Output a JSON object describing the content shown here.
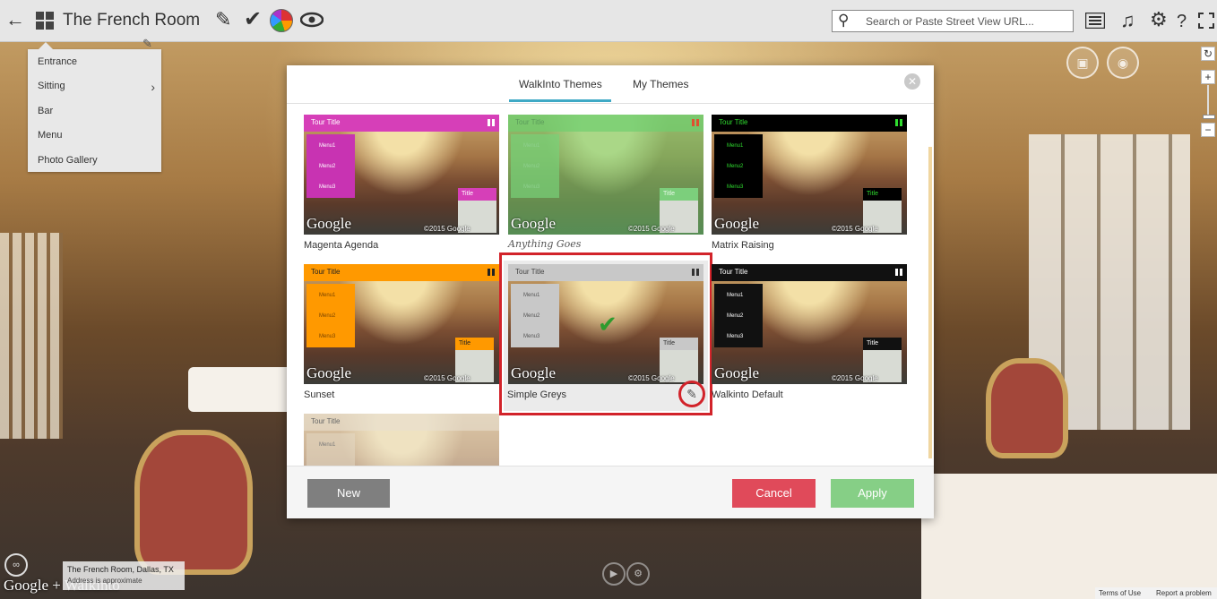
{
  "app": {
    "title": "The French Room"
  },
  "topbar": {
    "search_placeholder": "Search or Paste Street View URL..."
  },
  "side_menu": {
    "items": [
      {
        "label": "Entrance"
      },
      {
        "label": "Sitting",
        "has_submenu": true
      },
      {
        "label": "Bar"
      },
      {
        "label": "Menu"
      },
      {
        "label": "Photo Gallery"
      }
    ]
  },
  "modal": {
    "tabs": [
      {
        "label": "WalkInto Themes",
        "active": true
      },
      {
        "label": "My Themes",
        "active": false
      }
    ],
    "themes": [
      {
        "name": "Magenta Agenda",
        "tour_title": "Tour Title",
        "menu": [
          "Menu1",
          "Menu2",
          "Menu3"
        ],
        "title_box": "Title",
        "copyright": "©2015 Google",
        "accent": "#d63fb8"
      },
      {
        "name": "Anything Goes",
        "tour_title": "Tour Title",
        "menu": [
          "Menu1",
          "Menu2",
          "Menu3"
        ],
        "title_box": "Title",
        "copyright": "©2015 Google",
        "accent": "#6fcf6f"
      },
      {
        "name": "Matrix Raising",
        "tour_title": "Tour Title",
        "menu": [
          "Menu1",
          "Menu2",
          "Menu3"
        ],
        "title_box": "Title",
        "copyright": "©2015 Google",
        "accent": "#00e000"
      },
      {
        "name": "Sunset",
        "tour_title": "Tour Title",
        "menu": [
          "Menu1",
          "Menu2",
          "Menu3"
        ],
        "title_box": "Title",
        "copyright": "©2015 Google",
        "accent": "#ff9900"
      },
      {
        "name": "Simple Greys",
        "tour_title": "Tour Title",
        "menu": [
          "Menu1",
          "Menu2",
          "Menu3"
        ],
        "title_box": "Title",
        "copyright": "©2015 Google",
        "accent": "#c8c8c8",
        "selected": true
      },
      {
        "name": "Walkinto Default",
        "tour_title": "Tour Title",
        "menu": [
          "Menu1",
          "Menu2",
          "Menu3"
        ],
        "title_box": "Title",
        "copyright": "©2015 Google",
        "accent": "#111111"
      },
      {
        "name": "",
        "tour_title": "Tour Title",
        "menu": [
          "Menu1"
        ],
        "title_box": "",
        "copyright": "",
        "accent": "#e8e0d0"
      }
    ],
    "buttons": {
      "new": "New",
      "cancel": "Cancel",
      "apply": "Apply"
    },
    "colors": {
      "new": "#7f7f7f",
      "cancel": "#e04a5a",
      "apply": "#86cf86",
      "tab_accent": "#3fa9c5",
      "highlight": "#d2232a"
    }
  },
  "location_badge": {
    "name": "The French Room, Dallas, TX",
    "note": "Address is approximate"
  },
  "footer": {
    "google_logo": "Google",
    "brand": "+ Walkinto",
    "terms": "Terms of Use",
    "report": "Report a problem"
  }
}
